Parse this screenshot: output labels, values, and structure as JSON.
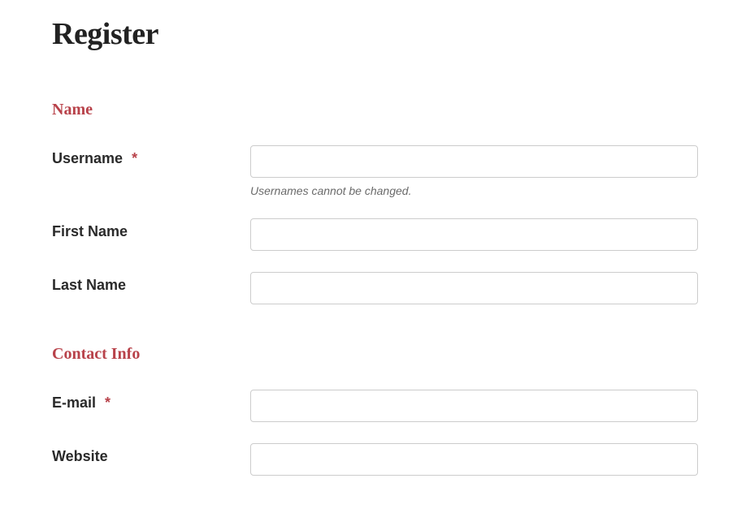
{
  "page": {
    "title": "Register"
  },
  "sections": {
    "name": {
      "heading": "Name",
      "fields": {
        "username": {
          "label": "Username",
          "required": "*",
          "value": "",
          "hint": "Usernames cannot be changed."
        },
        "first_name": {
          "label": "First Name",
          "value": ""
        },
        "last_name": {
          "label": "Last Name",
          "value": ""
        }
      }
    },
    "contact": {
      "heading": "Contact Info",
      "fields": {
        "email": {
          "label": "E-mail",
          "required": "*",
          "value": ""
        },
        "website": {
          "label": "Website",
          "value": ""
        }
      }
    }
  }
}
